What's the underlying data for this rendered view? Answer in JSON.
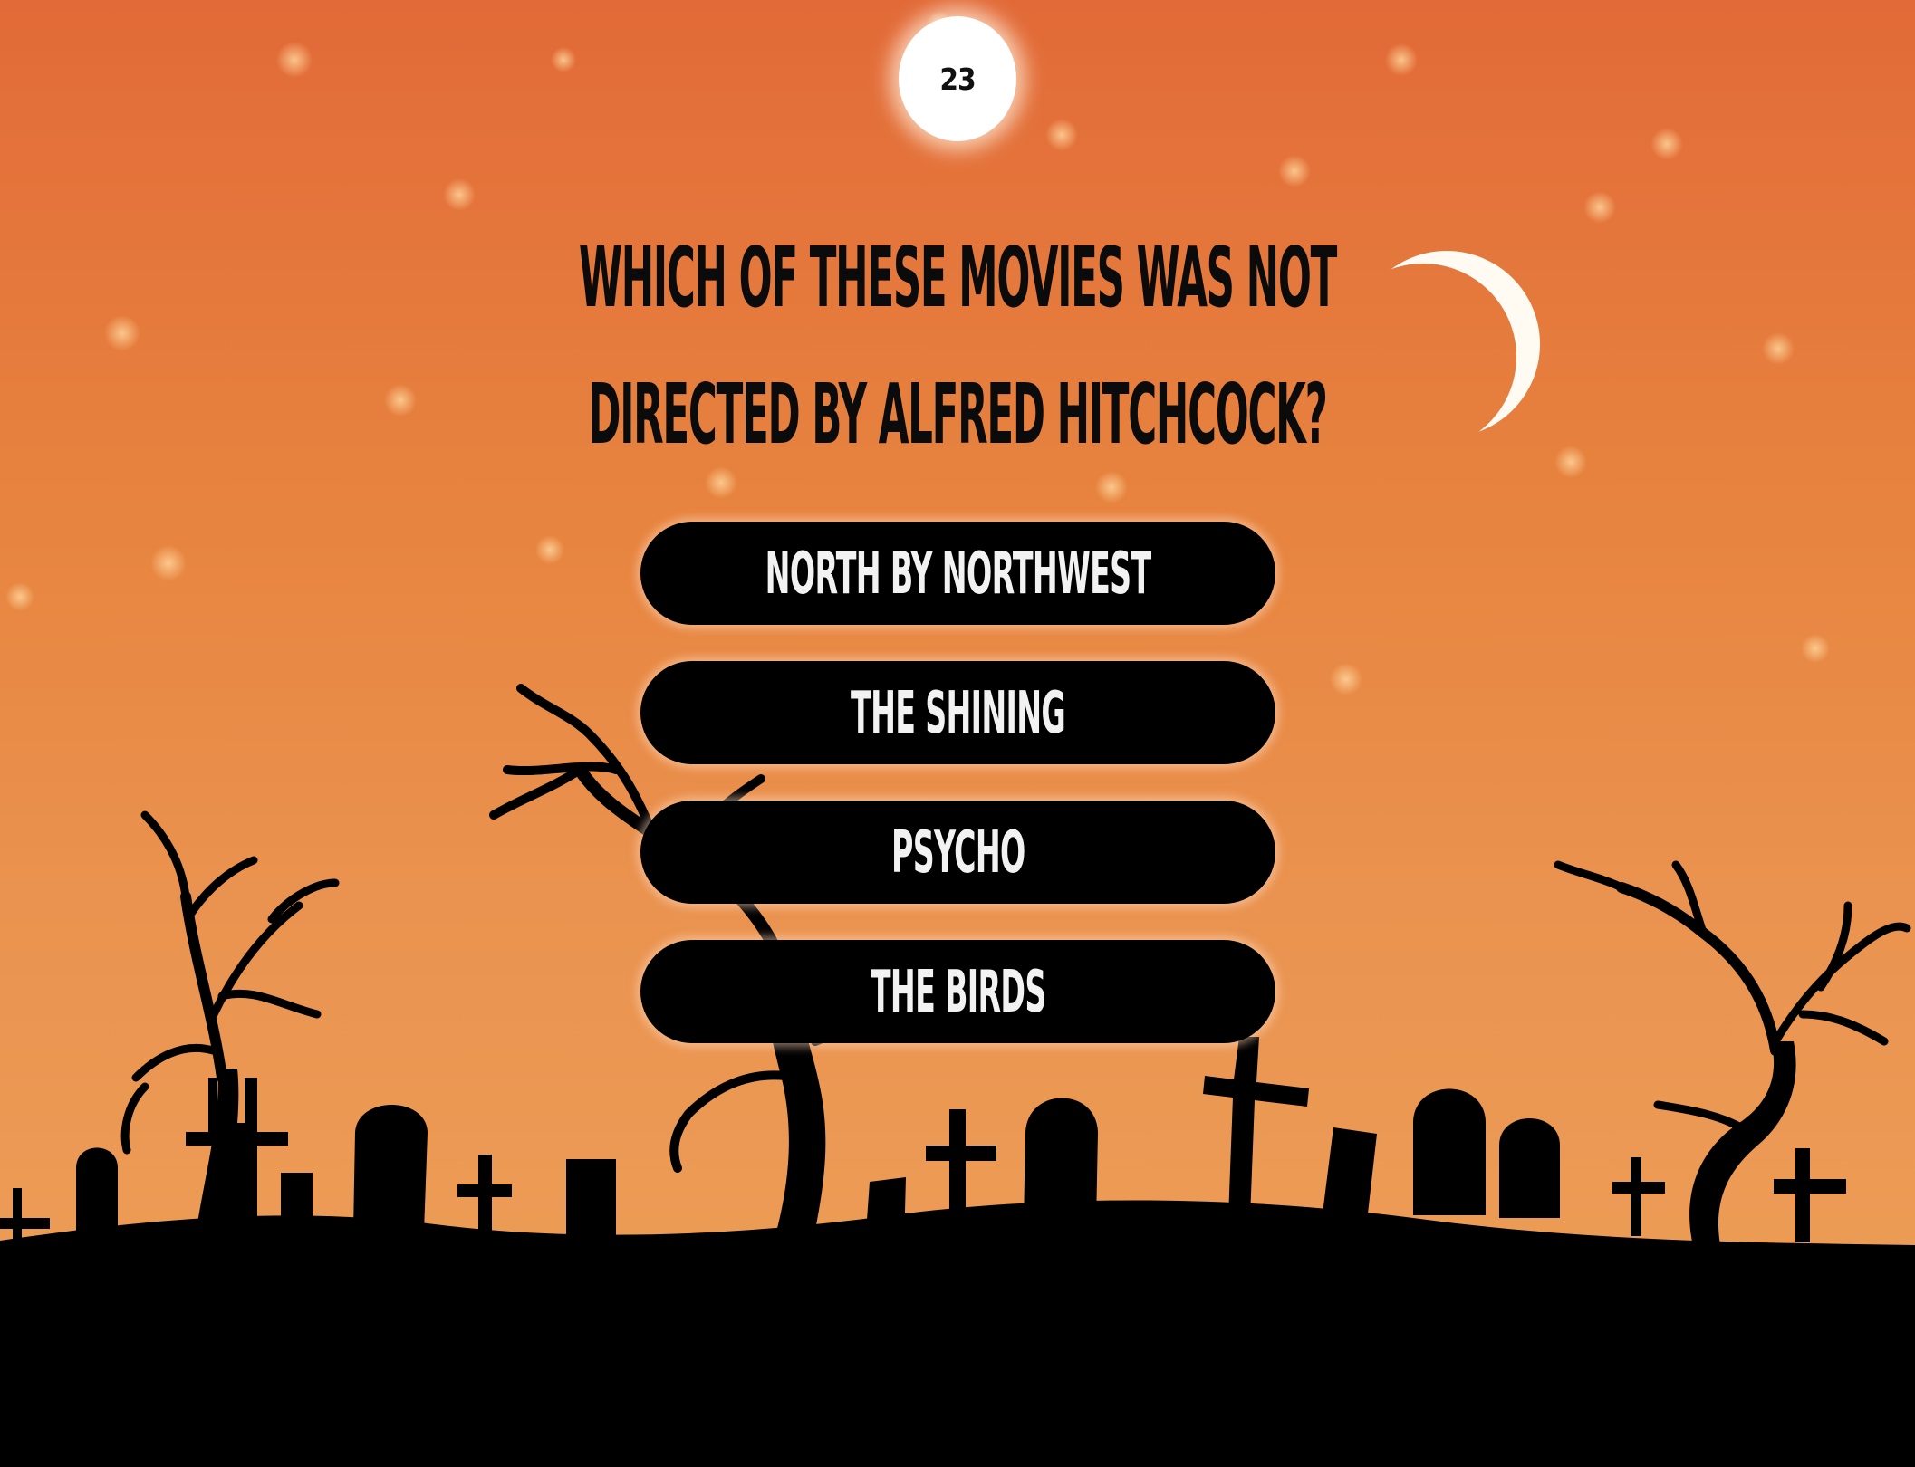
{
  "game": {
    "timer": "23",
    "question": "WHICH OF THESE MOVIES WAS NOT DIRECTED BY ALFRED HITCHCOCK?",
    "answers": [
      {
        "label": "NORTH BY NORTHWEST"
      },
      {
        "label": "THE SHINING"
      },
      {
        "label": "PSYCHO"
      },
      {
        "label": "THE BIRDS"
      }
    ]
  },
  "theme": {
    "sky_top": "#e26a38",
    "sky_bottom": "#eda159",
    "silhouette": "#000000",
    "moon": "#fffaf2",
    "button_bg": "#000000",
    "button_text": "#f2f2f2"
  },
  "icons": [
    "crescent-moon-icon",
    "graveyard-silhouette",
    "dead-tree-icon",
    "tombstone-icon",
    "cross-icon"
  ]
}
